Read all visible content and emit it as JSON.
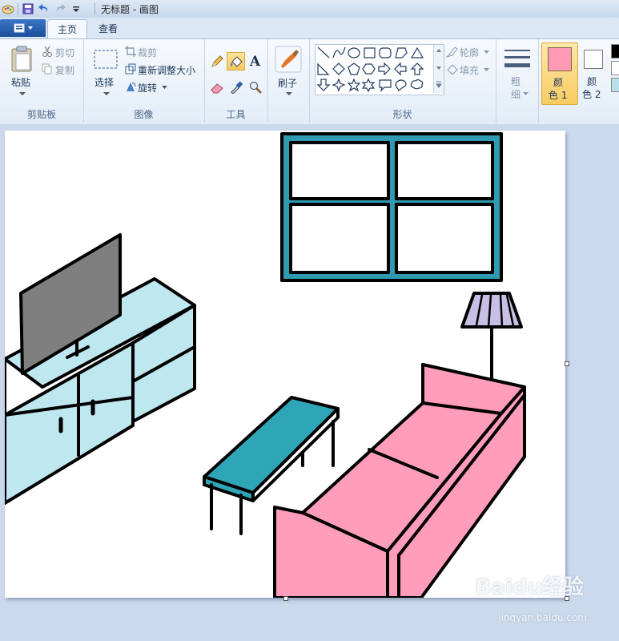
{
  "window": {
    "title": "无标题 - 画图"
  },
  "tabs": {
    "home": "主页",
    "view": "查看"
  },
  "clipboard": {
    "paste": "粘贴",
    "cut": "剪切",
    "copy": "复制",
    "group": "剪贴板"
  },
  "image": {
    "select": "选择",
    "crop": "裁剪",
    "resize": "重新调整大小",
    "rotate": "旋转",
    "group": "图像"
  },
  "tools": {
    "group": "工具",
    "text_glyph": "A"
  },
  "brushes": {
    "label": "刷子"
  },
  "shapes": {
    "outline": "轮廓",
    "fill": "填充",
    "group": "形状"
  },
  "size": {
    "label_line1": "粗",
    "label_line2": "细"
  },
  "colors": {
    "color1_line1": "颜",
    "color1_line2": "色 1",
    "color2_line1": "颜",
    "color2_line2": "色 2",
    "color1_value": "#ff99b4",
    "color2_value": "#ffffff"
  },
  "watermark": {
    "brand": "Baidu经验",
    "url": "jingyan.baidu.com"
  }
}
